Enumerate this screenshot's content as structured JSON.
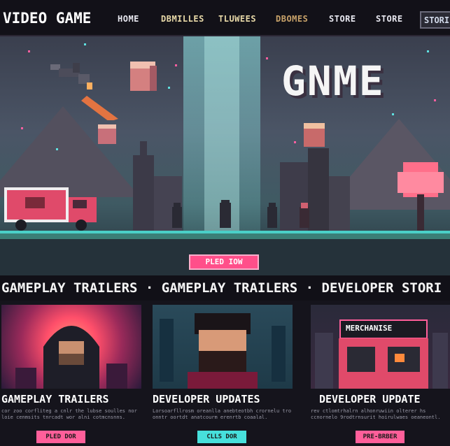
{
  "nav": {
    "brand": "VIDEO GAME",
    "items": [
      {
        "label": "HOME",
        "color": "#e8e8f0"
      },
      {
        "label": "DBMILLES",
        "color": "#e8d9a8"
      },
      {
        "label": "TLUWEES",
        "color": "#e8d9a8"
      },
      {
        "label": "DBOMES",
        "color": "#c9a36a"
      },
      {
        "label": "STORE",
        "color": "#e8e8f0"
      },
      {
        "label": "STORE",
        "color": "#e8e8f0"
      }
    ],
    "last_button": "STORI"
  },
  "hero": {
    "title": "GNME",
    "cta": "PLED IOW"
  },
  "marquee": {
    "text": "GAMEPLAY TRAILERS · GAMEPLAY TRAILERS · DEVELOPER STORI"
  },
  "cards": [
    {
      "title": "GAMEPLAY TRAILERS",
      "desc": "cor zoo corfliteg a cnlr the lubse soulles nor loie cenmsits tnrcadt wor alni cotmcnsnns.",
      "button": "PLED DOR",
      "button_color": "#ff5f9a",
      "icon": "hooded-figure-icon"
    },
    {
      "title": "DEVELOPER UPDATES",
      "desc": "Lorsoarfllrosm oreanlla anebteotbh crornelu tro onntr oortdt anatcourm erenrtb coaalal.",
      "button": "CLLS DOR",
      "button_color": "#47e0dc",
      "icon": "developer-portrait-icon"
    },
    {
      "title": "DEVELOPER UPDATE",
      "desc": "rev ctlomtrhalrn alhonruwiin olterer hs ccnornelo 9rodtrnsurit hoirulwaes oeaneontl.",
      "button": "PRE-BRBER",
      "button_color": "#ff5f9a",
      "icon": "merchandise-store-icon",
      "sign": "MERCHANISE"
    }
  ]
}
